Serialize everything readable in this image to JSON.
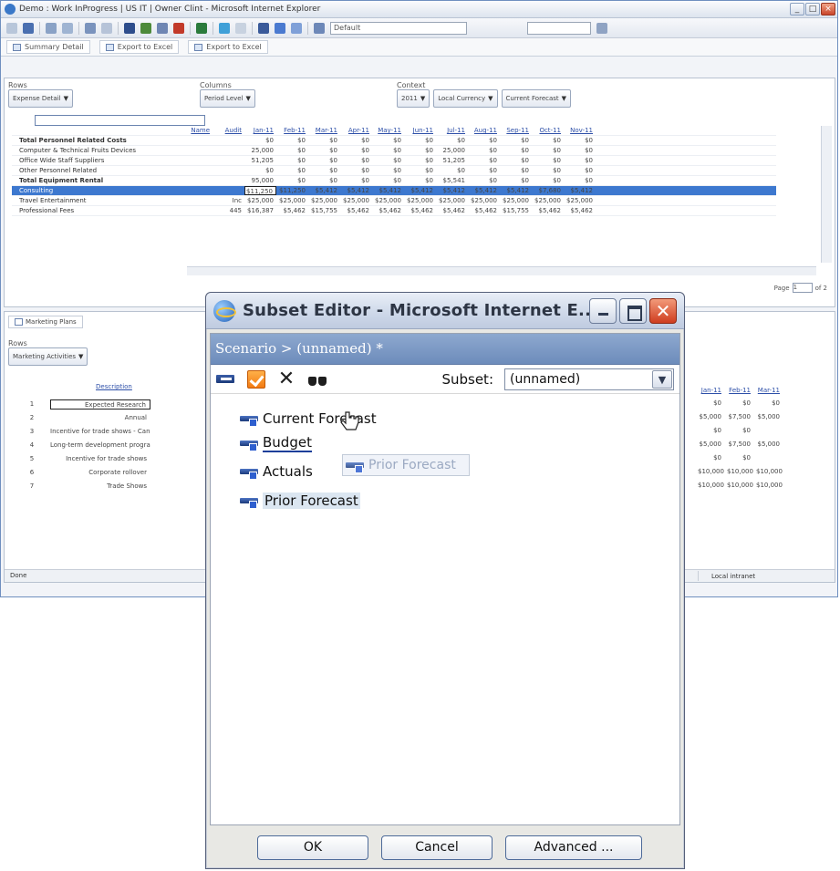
{
  "background_window": {
    "title": "Demo : Work InProgress | US IT | Owner Clint - Microsoft Internet Explorer",
    "toolbar_select_value": "Default",
    "tabs": [
      {
        "label": "Summary Detail"
      },
      {
        "label": "Export to Excel"
      },
      {
        "label": "Export to Excel"
      }
    ],
    "rows_label": "Rows",
    "rows_chip": "Expense Detail",
    "columns_label": "Columns",
    "columns_chip": "Period Level",
    "context_label": "Context",
    "context_chips": [
      "2011",
      "Local Currency",
      "Current Forecast"
    ],
    "upper_rows": [
      "Total Personnel Related Costs",
      "Computer & Technical Fruits Devices",
      "Office Wide Staff Suppliers",
      "Other Personnel Related",
      "Total Equipment Rental",
      "Consulting",
      "Travel Entertainment",
      "Professional Fees"
    ],
    "upper_headers": [
      "Name",
      "Audit",
      "Jan-11",
      "Feb-11",
      "Mar-11",
      "Apr-11",
      "May-11",
      "Jun-11",
      "Jul-11",
      "Aug-11",
      "Sep-11",
      "Oct-11",
      "Nov-11"
    ],
    "upper_values": [
      [
        "",
        "",
        "$0",
        "$0",
        "$0",
        "$0",
        "$0",
        "$0",
        "$0",
        "$0",
        "$0",
        "$0",
        "$0"
      ],
      [
        "",
        "",
        "25,000",
        "$0",
        "$0",
        "$0",
        "$0",
        "$0",
        "25,000",
        "$0",
        "$0",
        "$0",
        "$0"
      ],
      [
        "",
        "",
        "51,205",
        "$0",
        "$0",
        "$0",
        "$0",
        "$0",
        "51,205",
        "$0",
        "$0",
        "$0",
        "$0"
      ],
      [
        "",
        "",
        "$0",
        "$0",
        "$0",
        "$0",
        "$0",
        "$0",
        "$0",
        "$0",
        "$0",
        "$0",
        "$0"
      ],
      [
        "",
        "",
        "95,000",
        "$0",
        "$0",
        "$0",
        "$0",
        "$0",
        "$5,541",
        "$0",
        "$0",
        "$0",
        "$0"
      ],
      [
        "",
        "",
        "$11,250",
        "$11,250",
        "$5,412",
        "$5,412",
        "$5,412",
        "$5,412",
        "$5,412",
        "$5,412",
        "$5,412",
        "$7,680",
        "$5,412"
      ],
      [
        "",
        "Inc",
        "$25,000",
        "$25,000",
        "$25,000",
        "$25,000",
        "$25,000",
        "$25,000",
        "$25,000",
        "$25,000",
        "$25,000",
        "$25,000",
        "$25,000"
      ],
      [
        "",
        "445",
        "$16,387",
        "$5,462",
        "$15,755",
        "$5,462",
        "$5,462",
        "$5,462",
        "$5,462",
        "$5,462",
        "$15,755",
        "$5,462",
        "$5,462"
      ]
    ],
    "pager_label": "Page",
    "pager_value": "1",
    "pager_total": "of 2",
    "lower_tab": "Marketing Plans",
    "lower_rows_label": "Rows",
    "lower_chip": "Marketing Activities",
    "lower_header": "Description",
    "lower_rows": [
      {
        "num": "1",
        "txt": "Expected Research"
      },
      {
        "num": "2",
        "txt": "Annual"
      },
      {
        "num": "3",
        "txt": "Incentive for trade shows - Canada"
      },
      {
        "num": "4",
        "txt": "Long-term development program"
      },
      {
        "num": "5",
        "txt": "Incentive for trade shows"
      },
      {
        "num": "6",
        "txt": "Corporate rollover"
      },
      {
        "num": "7",
        "txt": "Trade Shows"
      }
    ],
    "lower_col_headers": [
      "Jan-11",
      "Feb-11",
      "Mar-11"
    ],
    "lower_values": [
      [
        "$0",
        "$0",
        "$0"
      ],
      [
        "$5,000",
        "$7,500",
        "$5,000"
      ],
      [
        "$0",
        "$0",
        ""
      ],
      [
        "$5,000",
        "$7,500",
        "$5,000"
      ],
      [
        "$0",
        "$0",
        ""
      ],
      [
        "$10,000",
        "$10,000",
        "$10,000"
      ],
      [
        "$10,000",
        "$10,000",
        "$10,000"
      ]
    ],
    "status_text": "Done",
    "zone_text": "Local intranet"
  },
  "dialog": {
    "title": "Subset Editor - Microsoft Internet E...",
    "scenario_path": "Scenario > (unnamed) *",
    "subset_label": "Subset:",
    "subset_value": "(unnamed)",
    "members": [
      {
        "label": "Current Forecast"
      },
      {
        "label": "Budget"
      },
      {
        "label": "Actuals"
      },
      {
        "label": "Prior Forecast"
      }
    ],
    "drag_ghost_label": "Prior Forecast",
    "buttons": {
      "ok": "OK",
      "cancel": "Cancel",
      "advanced": "Advanced ..."
    }
  }
}
